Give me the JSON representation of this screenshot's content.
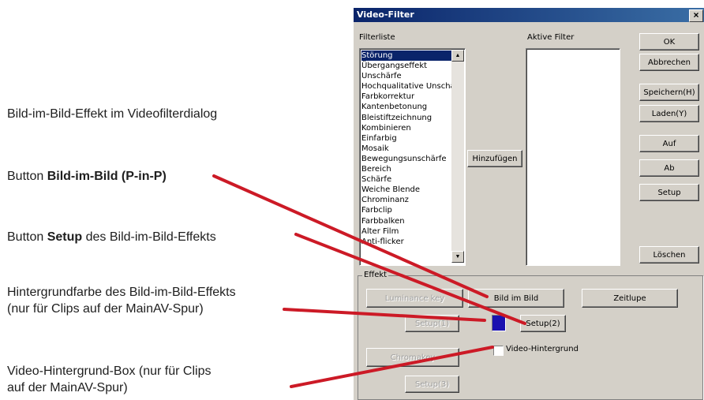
{
  "annotations": {
    "pip_effect": "Bild-im-Bild-Effekt im Videofilterdialog",
    "pip_button_prefix": "Button ",
    "pip_button_bold": "Bild-im-Bild (P-in-P)",
    "setup_button_prefix": "Button ",
    "setup_button_bold": "Setup",
    "setup_button_suffix": " des Bild-im-Bild-Effekts",
    "bgcolor_line1": "Hintergrundfarbe des Bild-im-Bild-Effekts",
    "bgcolor_line2": "(nur für Clips auf der MainAV-Spur)",
    "videobg_line1": "Video-Hintergrund-Box (nur für Clips",
    "videobg_line2": "auf der MainAV-Spur)"
  },
  "dialog": {
    "title": "Video-Filter",
    "close": "×",
    "filter_list_label": "Filterliste",
    "active_filters_label": "Aktive Filter",
    "filters": [
      "Störung",
      "Übergangseffekt",
      "Unschärfe",
      "Hochqualitative Unschä",
      "Farbkorrektur",
      "Kantenbetonung",
      "Bleistiftzeichnung",
      "Kombinieren",
      "Einfarbig",
      "Mosaik",
      "Bewegungsunschärfe",
      "Bereich",
      "Schärfe",
      "Weiche Blende",
      "Chrominanz",
      "Farbclip",
      "Farbbalken",
      "Alter Film",
      "Anti-flicker"
    ],
    "selected_filter": "Störung",
    "add_button": "Hinzufügen",
    "buttons": {
      "ok": "OK",
      "cancel": "Abbrechen",
      "save": "Speichern(H)",
      "load": "Laden(Y)",
      "up": "Auf",
      "down": "Ab",
      "setup": "Setup",
      "delete": "Löschen"
    },
    "effect_group": {
      "title": "Effekt",
      "luminance_key": "Luminance key",
      "setup1": "Setup(1)",
      "pip": "Bild im Bild",
      "slowmo": "Zeitlupe",
      "setup2": "Setup(2)",
      "video_bg": "Video-Hintergrund",
      "chromakey": "Chromakey",
      "setup3": "Setup(3)",
      "bg_color": "#1a11b0"
    },
    "scroll_up_icon": "▲",
    "scroll_down_icon": "▼"
  },
  "colors": {
    "pointer_line": "#cc1a26",
    "titlebar": "#0a246a"
  }
}
